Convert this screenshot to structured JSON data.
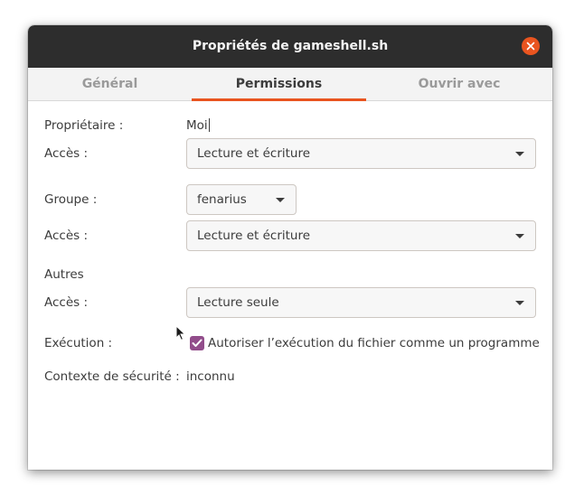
{
  "window": {
    "title": "Propriétés de gameshell.sh",
    "close_icon": "close-icon"
  },
  "tabs": [
    {
      "label": "Général",
      "active": false
    },
    {
      "label": "Permissions",
      "active": true
    },
    {
      "label": "Ouvrir avec",
      "active": false
    }
  ],
  "owner": {
    "label": "Propriétaire :",
    "value": "Moi",
    "access_label": "Accès :",
    "access_value": "Lecture et écriture"
  },
  "group": {
    "label": "Groupe :",
    "value": "fenarius",
    "access_label": "Accès :",
    "access_value": "Lecture et écriture"
  },
  "others": {
    "label": "Autres",
    "access_label": "Accès :",
    "access_value": "Lecture seule"
  },
  "execution": {
    "label": "Exécution :",
    "checkbox_label": "Autoriser l’exécution du fichier comme un programme",
    "checked": true
  },
  "security": {
    "label": "Contexte de sécurité :",
    "value": "inconnu"
  },
  "colors": {
    "accent": "#e9541f",
    "checkbox": "#924d8b",
    "titlebar": "#2d2d2d"
  }
}
